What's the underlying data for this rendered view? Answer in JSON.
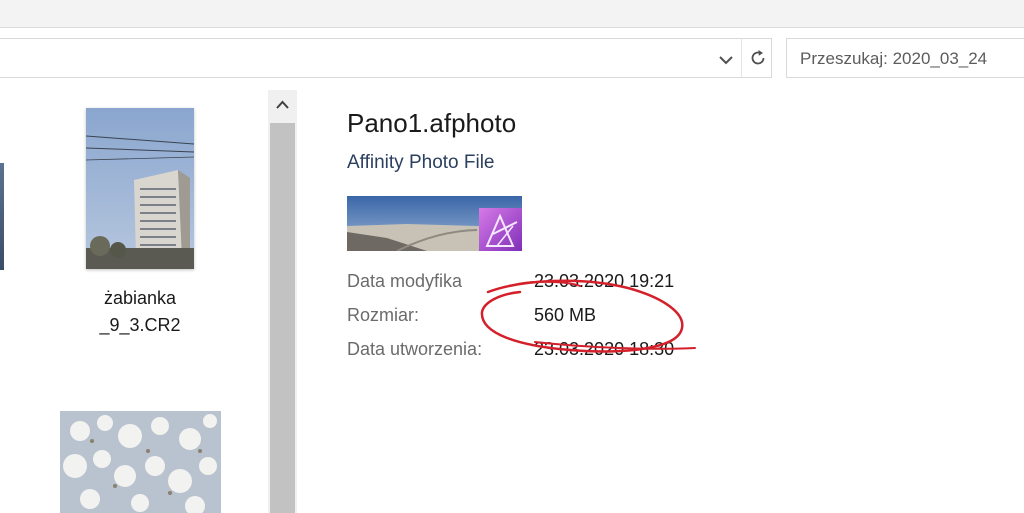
{
  "search": {
    "placeholder": "Przeszukaj: 2020_03_24"
  },
  "thumbnails": {
    "items": [
      {
        "label": "żabianka _9_3.CR2"
      }
    ]
  },
  "details": {
    "file_name": "Pano1.afphoto",
    "file_type": "Affinity Photo File",
    "properties": [
      {
        "label": "Data modyfika",
        "value": "23.03.2020 19:21"
      },
      {
        "label": "Rozmiar:",
        "value": "560 MB"
      },
      {
        "label": "Data utworzenia:",
        "value": "23.03.2020 18:30"
      }
    ]
  },
  "colors": {
    "annotation": "#d4202a",
    "affinity_logo": "#b34fd6",
    "scroll_thumb": "#c2c2c2"
  },
  "icons": [
    "chevron-down-icon",
    "refresh-icon",
    "scroll-up-icon",
    "affinity-photo-logo-icon"
  ]
}
